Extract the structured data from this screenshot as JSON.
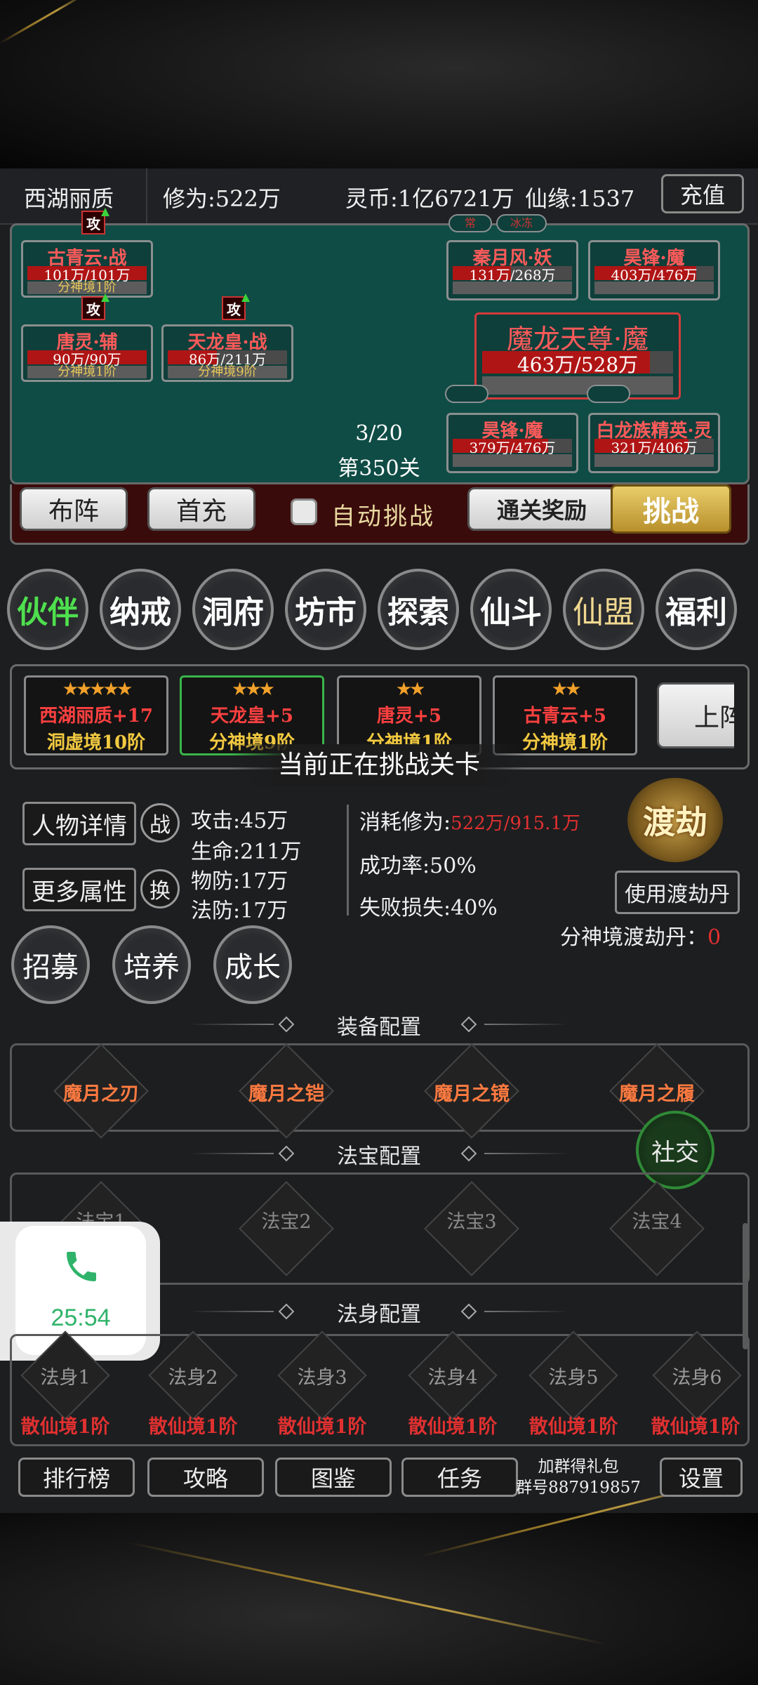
{
  "topbar": {
    "player_name": "西湖丽质",
    "cultivation": "修为:522万",
    "spirit_coins": "灵币:1亿6721万",
    "immortal_fate": "仙缘:1537",
    "recharge_button": "充值"
  },
  "battle": {
    "allies": [
      {
        "name": "古青云·战",
        "hp": "101万/101万",
        "realm": "分神境1阶",
        "hp_fraction": 1.0,
        "attack_badge": "攻"
      },
      {
        "name": "唐灵·辅",
        "hp": "90万/90万",
        "realm": "分神境1阶",
        "hp_fraction": 1.0,
        "attack_badge": "攻"
      },
      {
        "name": "天龙皇·战",
        "hp": "86万/211万",
        "realm": "分神境9阶",
        "hp_fraction": 0.41,
        "attack_badge": "攻"
      }
    ],
    "enemies": [
      {
        "name": "秦月风·妖",
        "hp": "131万/268万",
        "hp_fraction": 0.49
      },
      {
        "name": "昊锋·魔",
        "hp": "403万/476万",
        "hp_fraction": 0.85
      },
      {
        "name": "昊锋·魔",
        "hp": "379万/476万",
        "hp_fraction": 0.8
      },
      {
        "name": "白龙族精英·灵",
        "hp": "321万/406万",
        "hp_fraction": 0.79
      }
    ],
    "enemy_tags": [
      "常",
      "冰冻"
    ],
    "boss": {
      "name": "魔龙天尊·魔",
      "hp": "463万/528万",
      "hp_fraction": 0.88
    },
    "wave": "3/20",
    "stage": "第350关"
  },
  "controls": {
    "formation": "布阵",
    "first_recharge": "首充",
    "auto_challenge": "自动挑战",
    "clear_reward": "通关奖励",
    "challenge": "挑战"
  },
  "nav": [
    "伙伴",
    "纳戒",
    "洞府",
    "坊市",
    "探索",
    "仙斗",
    "仙盟",
    "福利"
  ],
  "partners": [
    {
      "stars": "★★★★★",
      "name": "西湖丽质+17",
      "realm": "洞虚境10阶"
    },
    {
      "stars": "★★★",
      "name": "天龙皇+5",
      "realm": "分神境9阶"
    },
    {
      "stars": "★★",
      "name": "唐灵+5",
      "realm": "分神境1阶"
    },
    {
      "stars": "★★",
      "name": "古青云+5",
      "realm": "分神境1阶"
    }
  ],
  "partner_next_label": "上阵",
  "challenge_banner": "当前正在挑战关卡",
  "character": {
    "detail_button": "人物详情",
    "battle_icon_label": "战",
    "more_attr_button": "更多属性",
    "swap_icon_label": "换",
    "attack": "攻击:45万",
    "hp": "生命:211万",
    "phys_def": "物防:17万",
    "mag_def": "法防:17万"
  },
  "tribulation": {
    "cost_label": "消耗修为:",
    "cost_value": "522万/915.1万",
    "success_rate": "成功率:50%",
    "fail_loss": "失败损失:40%",
    "emblem": "渡劫",
    "use_pill_button": "使用渡劫丹",
    "pill_label": "分神境渡劫丹：",
    "pill_count": "0"
  },
  "growth_buttons": [
    "招募",
    "培养",
    "成长"
  ],
  "equipment": {
    "title": "装备配置",
    "items": [
      "魔月之刃",
      "魔月之铠",
      "魔月之镜",
      "魔月之履"
    ]
  },
  "social_button": "社交",
  "treasure": {
    "title": "法宝配置",
    "items": [
      "法宝1",
      "法宝2",
      "法宝3",
      "法宝4"
    ]
  },
  "call_widget": {
    "time": "25:54"
  },
  "body_config": {
    "title": "法身配置",
    "items": [
      "法身1",
      "法身2",
      "法身3",
      "法身4",
      "法身5",
      "法身6"
    ],
    "realms": [
      "散仙境1阶",
      "散仙境1阶",
      "散仙境1阶",
      "散仙境1阶",
      "散仙境1阶",
      "散仙境1阶"
    ]
  },
  "bottom": {
    "ranking": "排行榜",
    "guide": "攻略",
    "codex": "图鉴",
    "tasks": "任务",
    "group_line1": "加群得礼包",
    "group_line2": "群号887919857",
    "settings": "设置"
  },
  "colors": {
    "battle_bg": "#0f4c45",
    "hp_red": "#b01515",
    "enemy_name": "#ff5a5a",
    "gold": "#f2c940",
    "cost_red": "#e03030",
    "nav_active": "#4ee04e",
    "nav_alliance": "#f0d890",
    "equip_orange": "#ff7a40",
    "call_green": "#2fb36a"
  }
}
